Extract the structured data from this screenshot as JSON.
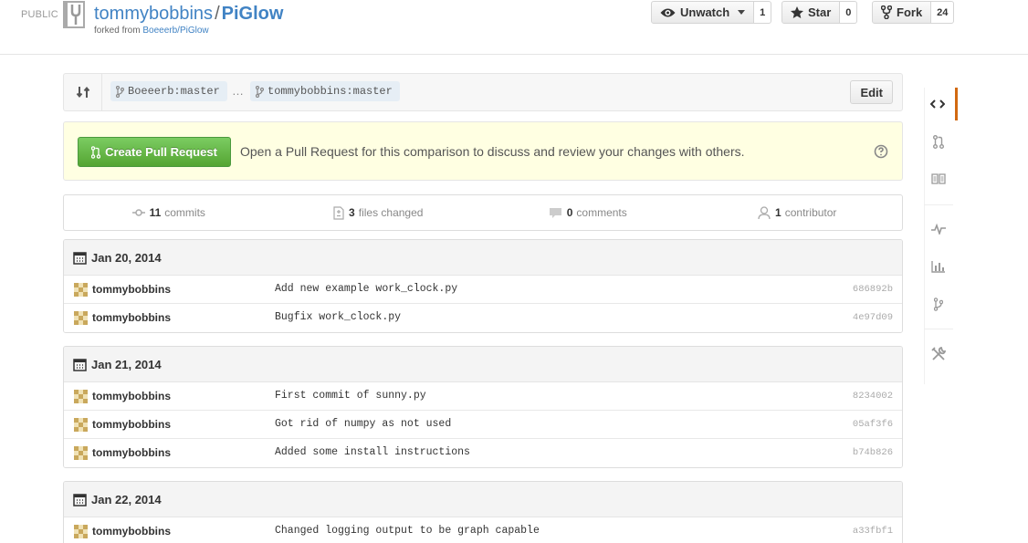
{
  "header": {
    "public_label": "PUBLIC",
    "owner": "tommybobbins",
    "separator": "/",
    "repo": "PiGlow",
    "forked_from_prefix": "forked from",
    "forked_from": "Boeeerb/PiGlow",
    "unwatch_label": "Unwatch",
    "unwatch_count": "1",
    "star_label": "Star",
    "star_count": "0",
    "fork_label": "Fork",
    "fork_count": "24"
  },
  "range": {
    "base": "Boeeerb:master",
    "ellipsis": "…",
    "head": "tommybobbins:master",
    "edit_label": "Edit"
  },
  "flash": {
    "button_label": "Create Pull Request",
    "message": "Open a Pull Request for this comparison to discuss and review your changes with others."
  },
  "stats": {
    "commits_count": "11",
    "commits_label": "commits",
    "files_count": "3",
    "files_label": "files changed",
    "comments_count": "0",
    "comments_label": "comments",
    "contributors_count": "1",
    "contributors_label": "contributor"
  },
  "commit_groups": [
    {
      "date": "Jan 20, 2014",
      "commits": [
        {
          "author": "tommybobbins",
          "message": "Add new example work_clock.py",
          "sha": "686892b"
        },
        {
          "author": "tommybobbins",
          "message": "Bugfix work_clock.py",
          "sha": "4e97d09"
        }
      ]
    },
    {
      "date": "Jan 21, 2014",
      "commits": [
        {
          "author": "tommybobbins",
          "message": "First commit of sunny.py",
          "sha": "8234002"
        },
        {
          "author": "tommybobbins",
          "message": "Got rid of numpy as not used",
          "sha": "05af3f6"
        },
        {
          "author": "tommybobbins",
          "message": "Added some install instructions",
          "sha": "b74b826"
        }
      ]
    },
    {
      "date": "Jan 22, 2014",
      "commits": [
        {
          "author": "tommybobbins",
          "message": "Changed logging output to be graph capable",
          "sha": "a33fbf1"
        }
      ]
    }
  ],
  "nav": {
    "items": [
      "code-icon",
      "pull-request-icon",
      "wiki-icon",
      "pulse-icon",
      "graphs-icon",
      "network-icon",
      "settings-icon"
    ],
    "accent_color": "#d26911"
  },
  "colors": {
    "link": "#4183c4",
    "create_button": "#55a532",
    "flash_bg": "#ffffe2"
  }
}
